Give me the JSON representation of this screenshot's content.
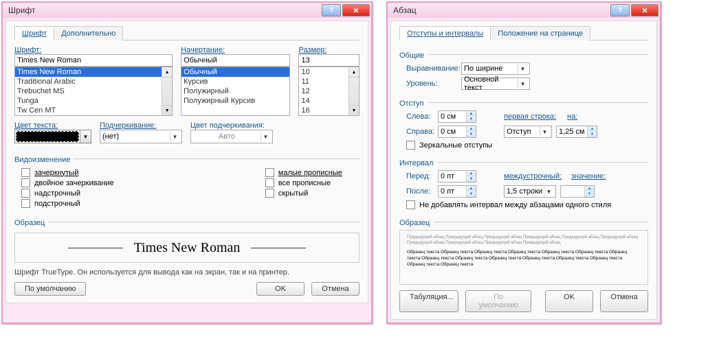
{
  "font_dialog": {
    "title": "Шрифт",
    "tabs": [
      "Шрифт",
      "Дополнительно"
    ],
    "labels": {
      "font": "Шрифт:",
      "style": "Начертание:",
      "size": "Размер:",
      "text_color": "Цвет текста:",
      "underline": "Подчеркивание:",
      "underline_color": "Цвет подчеркивания:",
      "effects": "Видоизменение",
      "sample": "Образец"
    },
    "font_value": "Times New Roman",
    "font_list": [
      "Times New Roman",
      "Traditional Arabic",
      "Trebuchet MS",
      "Tunga",
      "Tw Cen MT"
    ],
    "style_value": "Обычный",
    "style_list": [
      "Обычный",
      "Курсив",
      "Полужирный",
      "Полужирный Курсив"
    ],
    "size_value": "13",
    "size_list": [
      "10",
      "11",
      "12",
      "14",
      "16"
    ],
    "underline_value": "(нет)",
    "underline_color_value": "Авто",
    "effects": {
      "left": [
        "зачеркнутый",
        "двойное зачеркивание",
        "надстрочный",
        "подстрочный"
      ],
      "right": [
        "малые прописные",
        "все прописные",
        "скрытый"
      ]
    },
    "sample_text": "Times New Roman",
    "note": "Шрифт TrueType. Он используется для вывода как на экран, так и на принтер.",
    "buttons": {
      "default": "По умолчанию",
      "ok": "OK",
      "cancel": "Отмена"
    }
  },
  "para_dialog": {
    "title": "Абзац",
    "tabs": [
      "Отступы и интервалы",
      "Положение на странице"
    ],
    "groups": {
      "general": "Общие",
      "indent": "Отступ",
      "interval": "Интервал",
      "sample": "Образец"
    },
    "labels": {
      "align": "Выравнивание:",
      "level": "Уровень:",
      "left": "Слева:",
      "right": "Справа:",
      "first_line": "первая строка:",
      "by": "на:",
      "before": "Перед:",
      "after": "После:",
      "line_spacing": "междустрочный:",
      "value": "значение:",
      "mirror": "Зеркальные отступы",
      "no_add": "Не добавлять интервал между абзацами одного стиля"
    },
    "align_value": "По ширине",
    "level_value": "Основной текст",
    "left_value": "0 см",
    "right_value": "0 см",
    "first_line_value": "Отступ",
    "by_value": "1,25 см",
    "before_value": "0 пт",
    "after_value": "0 пт",
    "line_spacing_value": "1,5 строки",
    "value_value": "",
    "sample_lorem_grey": "Предыдущий абзац Предыдущий абзац Предыдущий абзац Предыдущий абзац Предыдущий абзац Предыдущий абзац Предыдущий абзац Предыдущий абзац Предыдущий абзац Предыдущий абзац",
    "sample_lorem_black": "Образец текста Образец текста Образец текста Образец текста Образец текста Образец текста Образец текста Образец текста Образец текста Образец текста Образец текста Образец текста Образец текста Образец текста Образец текста",
    "buttons": {
      "tabs": "Табуляция...",
      "default": "По умолчанию",
      "ok": "OK",
      "cancel": "Отмена"
    }
  }
}
